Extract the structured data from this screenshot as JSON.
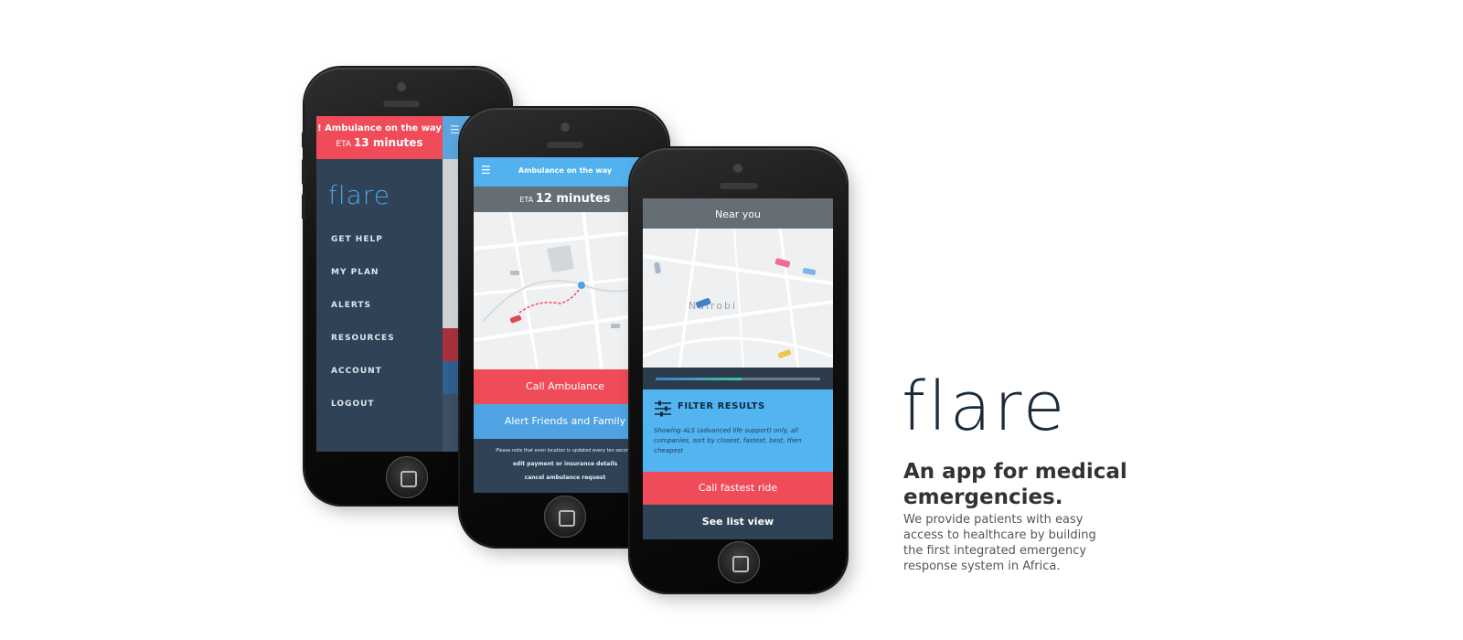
{
  "phone1": {
    "alert": {
      "line1": "! Ambulance on the way",
      "eta_prefix": "ETA",
      "eta_value": "13 minutes"
    },
    "logo": "flare",
    "menu": [
      {
        "label": "GET HELP"
      },
      {
        "label": "MY PLAN"
      },
      {
        "label": "ALERTS"
      },
      {
        "label": "RESOURCES"
      },
      {
        "label": "ACCOUNT"
      },
      {
        "label": "LOGOUT"
      }
    ]
  },
  "phone2": {
    "header_title": "Ambulance on the way",
    "eta_prefix": "ETA",
    "eta_value": "12 minutes",
    "call_button": "Call Ambulance",
    "alert_button": "Alert Friends and Family",
    "footer": {
      "note": "Please note that even location is updated every ten seconds",
      "link1": "edit payment or insurance details",
      "link2": "cancel ambulance request"
    }
  },
  "phone3": {
    "header_title": "Near you",
    "map_label": "Nairobi",
    "progress": 0.52,
    "filter": {
      "heading": "FILTER RESULTS",
      "description": "Showing ALS (advanced life support) only, all companies, sort by closest, fastest, best, then cheapest"
    },
    "call_button": "Call fastest ride",
    "list_button": "See list view"
  },
  "marketing": {
    "logo": "flare",
    "headline": "An app for medical emergencies.",
    "tagline": "We provide patients with easy access to healthcare by building the first integrated emergency response system in Africa."
  },
  "colors": {
    "navy": "#2f4256",
    "red": "#ef4b58",
    "blue": "#51b2ef",
    "gray_header": "#656d75"
  },
  "icons": [
    "menu-icon",
    "filter-sliders-icon",
    "location-pin-icon",
    "car-icon"
  ]
}
